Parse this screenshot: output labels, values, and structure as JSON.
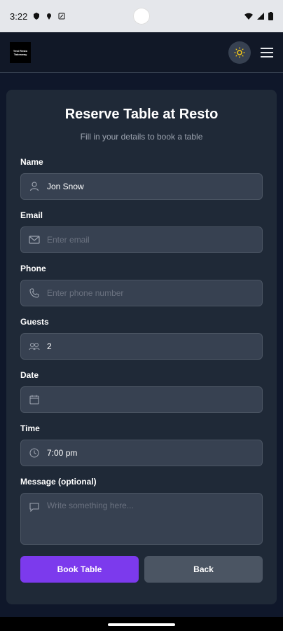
{
  "status_bar": {
    "time": "3:22",
    "icons": [
      "shield-icon",
      "location-icon",
      "notification-icon",
      "wifi-icon",
      "signal-icon",
      "battery-icon"
    ]
  },
  "header": {
    "logo_text": "Test Resto Takeaway",
    "theme_icon": "sun-icon",
    "menu_icon": "hamburger-icon"
  },
  "form": {
    "title": "Reserve Table at Resto",
    "subtitle": "Fill in your details to book a table",
    "fields": {
      "name": {
        "label": "Name",
        "value": "Jon Snow",
        "placeholder": "",
        "icon": "user-icon"
      },
      "email": {
        "label": "Email",
        "value": "",
        "placeholder": "Enter email",
        "icon": "mail-icon"
      },
      "phone": {
        "label": "Phone",
        "value": "",
        "placeholder": "Enter phone number",
        "icon": "phone-icon"
      },
      "guests": {
        "label": "Guests",
        "value": "2",
        "placeholder": "",
        "icon": "guests-icon"
      },
      "date": {
        "label": "Date",
        "value": "",
        "placeholder": "",
        "icon": "calendar-icon"
      },
      "time": {
        "label": "Time",
        "value": "7:00 pm",
        "placeholder": "",
        "icon": "clock-icon"
      },
      "message": {
        "label": "Message (optional)",
        "value": "",
        "placeholder": "Write something here...",
        "icon": "message-icon"
      }
    },
    "buttons": {
      "book": "Book Table",
      "back": "Back"
    }
  },
  "colors": {
    "background": "#0f172a",
    "card": "#1f2937",
    "input": "#374151",
    "primary": "#7c3aed",
    "secondary": "#4b5563"
  }
}
